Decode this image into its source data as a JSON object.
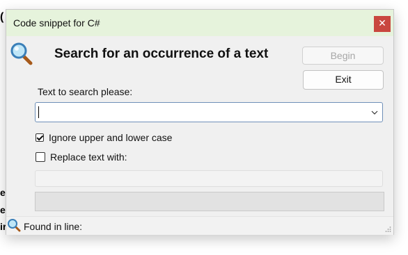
{
  "window": {
    "title": "Code snippet for C#",
    "close_glyph": "✕"
  },
  "heading": "Search for an occurrence of a text",
  "buttons": {
    "begin": "Begin",
    "exit": "Exit"
  },
  "search": {
    "label": "Text to search please:",
    "value": ""
  },
  "options": {
    "ignore_case_label": "Ignore upper and lower case",
    "ignore_case_checked": true,
    "replace_label": "Replace text with:",
    "replace_checked": false
  },
  "status": {
    "text": "Found in line:"
  },
  "background_text": {
    "frag1": "(",
    "frag2": "e",
    "frag3": "e",
    "frag4": "ir",
    "frag5": "\""
  },
  "icons": {
    "app": "magnifier-icon",
    "status": "magnifier-icon",
    "dropdown": "chevron-down-icon",
    "grip": "resize-grip-icon"
  },
  "colors": {
    "titlebar": "#e6f3dc",
    "close": "#c9473f",
    "disabled_text": "#a6a6a6"
  }
}
